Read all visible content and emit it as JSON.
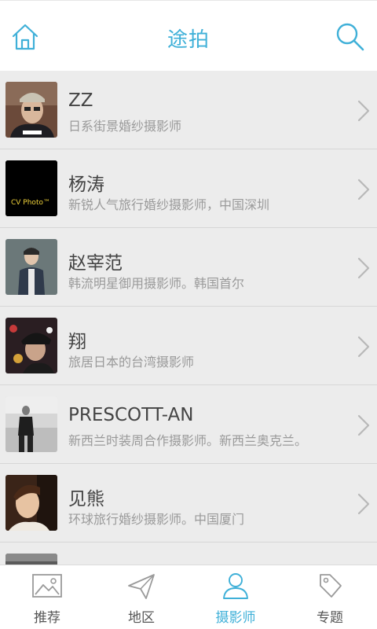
{
  "header": {
    "title": "途拍",
    "home_icon": "home-icon",
    "search_icon": "search-icon",
    "accent_color": "#3fb0d8"
  },
  "photographers": [
    {
      "name": "ZZ",
      "desc": "日系街景婚纱摄影师"
    },
    {
      "name": "杨涛",
      "desc": "新锐人气旅行婚纱摄影师，中国深圳",
      "avatar_text": "CV Photo™"
    },
    {
      "name": "赵宰范",
      "desc": "韩流明星御用摄影师。韩国首尔"
    },
    {
      "name": "翔",
      "desc": "旅居日本的台湾摄影师"
    },
    {
      "name": "PRESCOTT-AN",
      "desc": "新西兰时装周合作摄影师。新西兰奥克兰。"
    },
    {
      "name": "见熊",
      "desc": "环球旅行婚纱摄影师。中国厦门"
    },
    {
      "name": "",
      "desc": ""
    }
  ],
  "tabs": [
    {
      "label": "推荐",
      "icon": "image-icon",
      "active": false
    },
    {
      "label": "地区",
      "icon": "paper-plane-icon",
      "active": false
    },
    {
      "label": "摄影师",
      "icon": "person-icon",
      "active": true
    },
    {
      "label": "专题",
      "icon": "tag-icon",
      "active": false
    }
  ]
}
